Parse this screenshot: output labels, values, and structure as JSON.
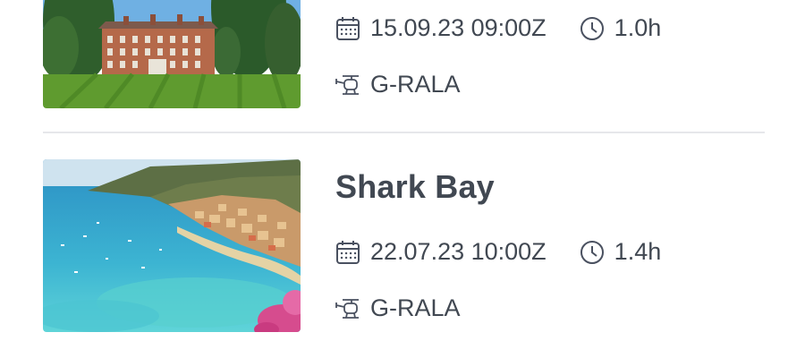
{
  "flights": [
    {
      "title": "",
      "date_time": "15.09.23 09:00Z",
      "duration": "1.0h",
      "aircraft": "G-RALA",
      "image": "manor-house-lawn"
    },
    {
      "title": "Shark Bay",
      "date_time": "22.07.23 10:00Z",
      "duration": "1.4h",
      "aircraft": "G-RALA",
      "image": "coastal-bay-town"
    }
  ]
}
